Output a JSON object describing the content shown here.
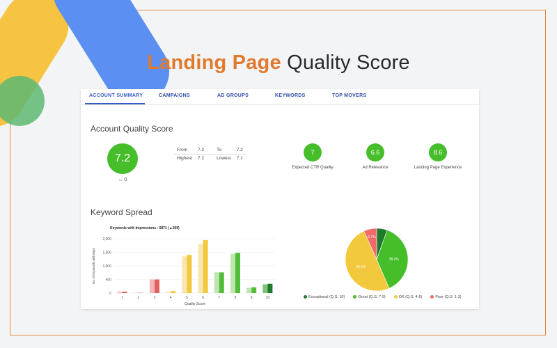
{
  "headline": {
    "accent": "Landing Page",
    "rest": "Quality Score"
  },
  "tabs": [
    {
      "label": "ACCOUNT SUMMARY"
    },
    {
      "label": "CAMPAIGNS"
    },
    {
      "label": "AD GROUPS"
    },
    {
      "label": "KEYWORDS"
    },
    {
      "label": "TOP MOVERS"
    }
  ],
  "account_quality": {
    "title": "Account Quality Score",
    "score": "7.2",
    "change": "↔ 0",
    "stats": {
      "from_label": "From",
      "from_value": "7.2",
      "to_label": "To",
      "to_value": "7.2",
      "highest_label": "Highest",
      "highest_value": "7.2",
      "lowest_label": "Lowest",
      "lowest_value": "7.1"
    },
    "components": [
      {
        "value": "7",
        "label": "Expected CTR Quality"
      },
      {
        "value": "6.6",
        "label": "Ad Relevance"
      },
      {
        "value": "8.6",
        "label": "Landing Page Experience"
      }
    ],
    "accent_color": "#45be2a"
  },
  "keyword_spread": {
    "title": "Keyword Spread",
    "chart_title": "Keywords with Impressions : 5871 (▲269)"
  },
  "chart_data": [
    {
      "type": "bar",
      "title": "Keywords with Impressions : 5871 (▲269)",
      "xlabel": "Quality Score",
      "ylabel": "No of Keywords with imps",
      "categories": [
        "1",
        "2",
        "3",
        "4",
        "5",
        "6",
        "7",
        "8",
        "9",
        "10"
      ],
      "ylim": [
        0,
        2000
      ],
      "yticks": [
        "0",
        "500",
        "1,000",
        "1,500",
        "2,000"
      ],
      "series": [
        {
          "values": [
            50,
            10,
            500,
            40,
            1350,
            1800,
            760,
            1450,
            190,
            320
          ]
        },
        {
          "values": [
            50,
            10,
            500,
            70,
            1400,
            1950,
            760,
            1480,
            210,
            340
          ]
        }
      ],
      "colors": {
        "1": [
          "#f4b6b6",
          "#e26262"
        ],
        "2": [
          "#f4b6b6",
          "#e26262"
        ],
        "3": [
          "#f4b6b6",
          "#e26262"
        ],
        "4": [
          "#f8e6b0",
          "#f2c83c"
        ],
        "5": [
          "#f8e6b0",
          "#f2c83c"
        ],
        "6": [
          "#f8e6b0",
          "#f2c83c"
        ],
        "7": [
          "#bfe6b0",
          "#52bd3a"
        ],
        "8": [
          "#bfe6b0",
          "#52bd3a"
        ],
        "9": [
          "#bfe6b0",
          "#52bd3a"
        ],
        "10": [
          "#7fc47a",
          "#1f7a2c"
        ]
      },
      "grid": true
    },
    {
      "type": "pie",
      "labels": [
        "Exceptional (Q.S. 10)",
        "Great (Q.S. 7-9)",
        "OK (Q.S. 4-6)",
        "Poor (Q.S. 1-3)"
      ],
      "values": [
        5.5,
        38.2,
        50.1,
        6.7
      ],
      "data_labels": [
        "",
        "38.2%",
        "50.1%",
        "6.7%"
      ],
      "colors": [
        "#1f7a2c",
        "#45be2a",
        "#f2c83c",
        "#f06a6a"
      ]
    }
  ]
}
